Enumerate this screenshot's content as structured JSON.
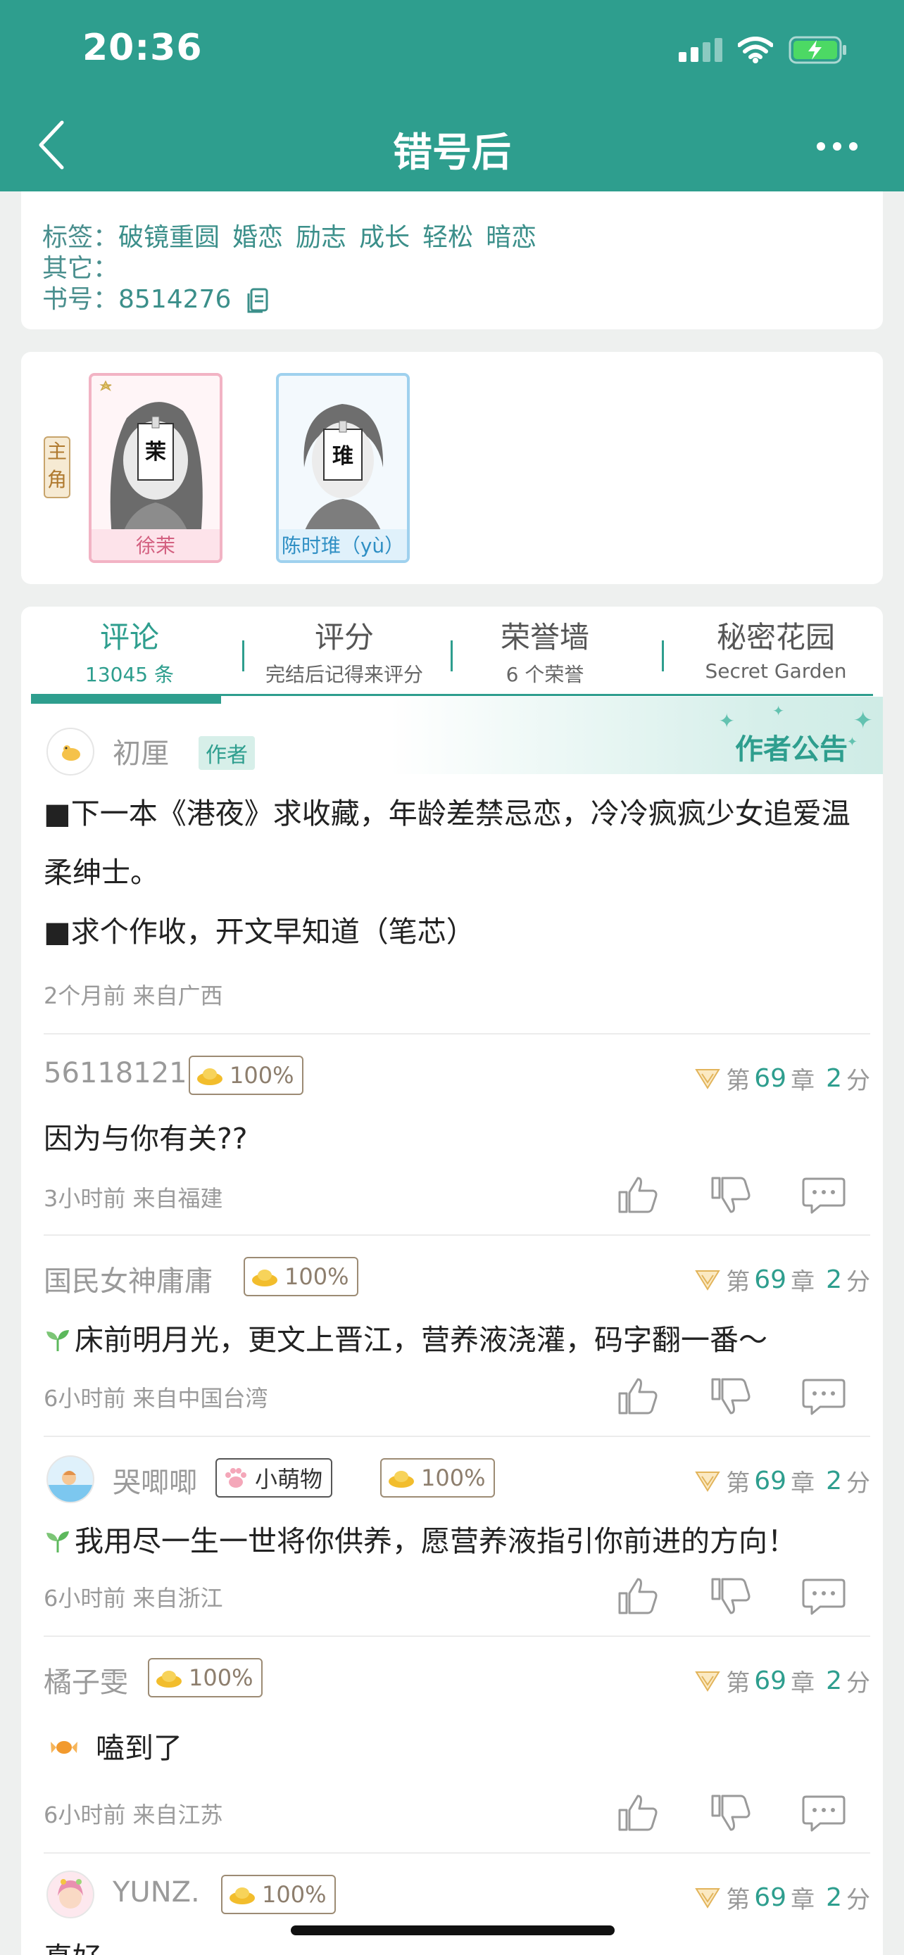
{
  "status_bar": {
    "time": "20:36"
  },
  "nav": {
    "title": "错号后"
  },
  "book_info": {
    "tags_label": "标签：",
    "tags": [
      "破镜重圆",
      "婚恋",
      "励志",
      "成长",
      "轻松",
      "暗恋"
    ],
    "other_label": "其它：",
    "book_no_label": "书号：",
    "book_no": "8514276"
  },
  "characters": {
    "role_label": "主角",
    "items": [
      {
        "name": "徐茉",
        "face_char": "茉"
      },
      {
        "name": "陈时琟（yù）",
        "face_char": "琟"
      }
    ]
  },
  "tabs": [
    {
      "label": "评论",
      "sub": "13045 条"
    },
    {
      "label": "评分",
      "sub": "完结后记得来评分"
    },
    {
      "label": "荣誉墙",
      "sub": "6 个荣誉"
    },
    {
      "label": "秘密花园",
      "sub": "Secret Garden"
    }
  ],
  "notice": {
    "banner_label": "作者公告",
    "author_name": "初厘",
    "author_badge": "作者",
    "line1": "■下一本《港夜》求收藏，年龄差禁忌恋，冷冷疯疯少女追爱温柔绅士。",
    "line2": "■求个作收，开文早知道（笔芯）",
    "meta": "2个月前  来自广西"
  },
  "comments": [
    {
      "user": "56118121",
      "vip": "100%",
      "chapter_prefix": "第",
      "chapter": "69",
      "chapter_mid": "章",
      "score": "2",
      "score_suffix": "分",
      "text": "因为与你有关??",
      "meta": "3小时前  来自福建"
    },
    {
      "user": "国民女神庸庸",
      "vip": "100%",
      "chapter_prefix": "第",
      "chapter": "69",
      "chapter_mid": "章",
      "score": "2",
      "score_suffix": "分",
      "text": "床前明月光，更文上晋江，营养液浇灌，码字翻一番～",
      "meta": "6小时前  来自中国台湾"
    },
    {
      "user": "哭唧唧",
      "pet_badge": "小萌物",
      "vip": "100%",
      "chapter_prefix": "第",
      "chapter": "69",
      "chapter_mid": "章",
      "score": "2",
      "score_suffix": "分",
      "text": "我用尽一生一世将你供养，愿营养液指引你前进的方向！",
      "meta": "6小时前  来自浙江"
    },
    {
      "user": "橘子雯",
      "vip": "100%",
      "chapter_prefix": "第",
      "chapter": "69",
      "chapter_mid": "章",
      "score": "2",
      "score_suffix": "分",
      "text": "嗑到了",
      "meta": "6小时前  来自江苏"
    },
    {
      "user": "YUNZ.",
      "vip": "100%",
      "chapter_prefix": "第",
      "chapter": "69",
      "chapter_mid": "章",
      "score": "2",
      "score_suffix": "分",
      "text": "真好",
      "meta": ""
    }
  ],
  "colors": {
    "theme": "#2e9e8e",
    "gold": "#e9b93a"
  }
}
